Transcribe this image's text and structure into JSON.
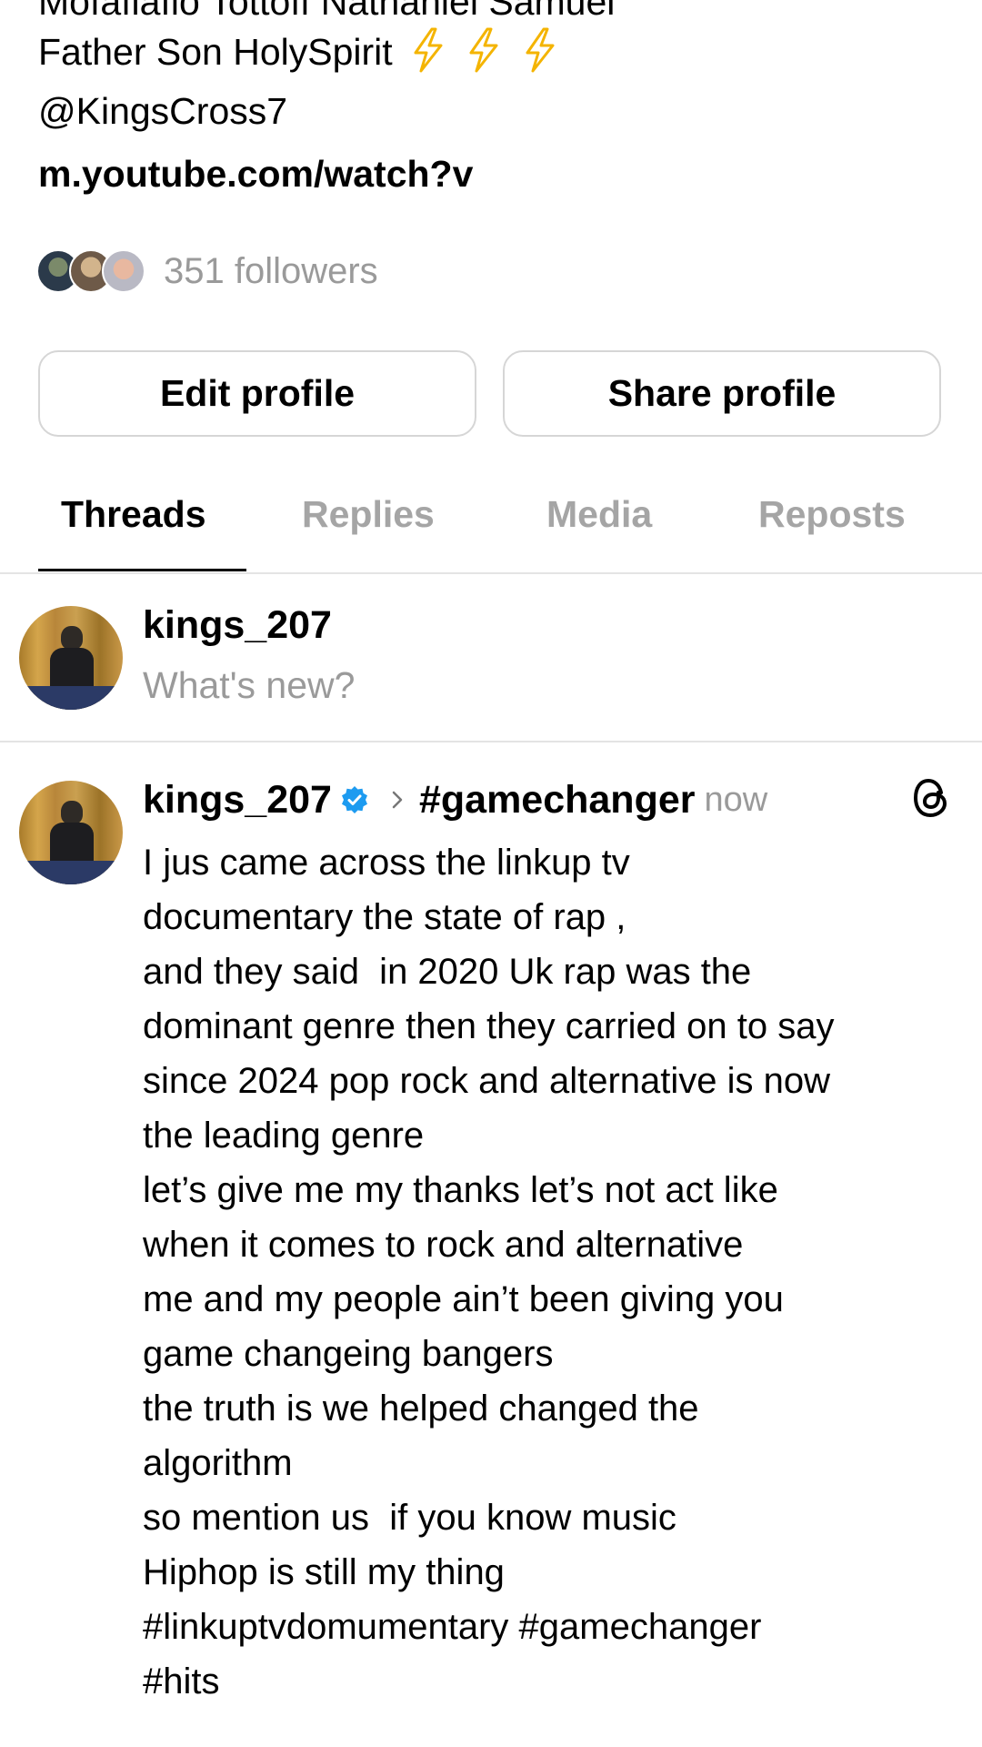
{
  "profile": {
    "bio_cut_line": "Mofafiafio Tottoff Nathaniel Samuel",
    "bio_line_1": "Father Son HolySpirit",
    "bio_line_2": "@KingsCross7",
    "bio_link": "m.youtube.com/watch?v",
    "followers_label": "351 followers",
    "bolt_color": "#f4b400"
  },
  "actions": {
    "edit_label": "Edit profile",
    "share_label": "Share profile"
  },
  "tabs": [
    {
      "label": "Threads",
      "active": true
    },
    {
      "label": "Replies",
      "active": false
    },
    {
      "label": "Media",
      "active": false
    },
    {
      "label": "Reposts",
      "active": false
    }
  ],
  "composer": {
    "username": "kings_207",
    "placeholder": "What's new?"
  },
  "post": {
    "username": "kings_207",
    "topic": "#gamechanger",
    "time": "now",
    "verified_color": "#1d9bf0",
    "lines": [
      "I jus came across the linkup tv\ndocumentary the state of rap ,",
      "and they said  in 2020 Uk rap was the\ndominant genre then they carried on to say\nsince 2024 pop rock and alternative is now\nthe leading genre",
      "let’s give me my thanks let’s not act like\nwhen it comes to rock and alternative",
      "me and my people ain’t been giving you\ngame changeing bangers",
      "the truth is we helped changed the\nalgorithm",
      "so mention us  if you know music",
      "Hiphop is still my thing",
      "#linkuptvdomumentary #gamechanger\n#hits"
    ]
  }
}
